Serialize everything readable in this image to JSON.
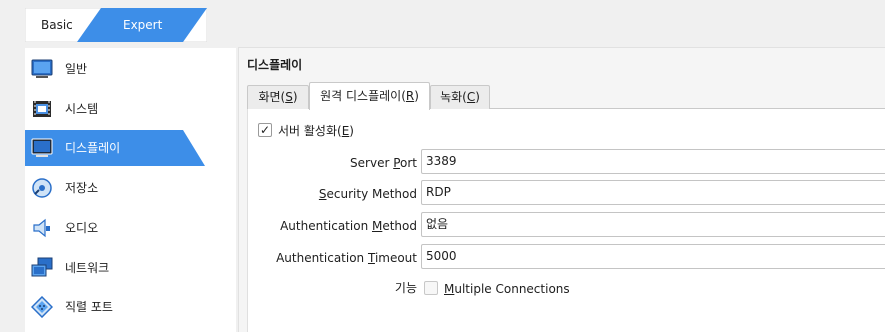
{
  "mode": {
    "basic_label": "Basic",
    "expert_label": "Expert"
  },
  "sidebar": {
    "items": [
      {
        "label": "일반",
        "icon": "monitor-icon"
      },
      {
        "label": "시스템",
        "icon": "chip-icon"
      },
      {
        "label": "디스플레이",
        "icon": "display-icon"
      },
      {
        "label": "저장소",
        "icon": "disk-icon"
      },
      {
        "label": "오디오",
        "icon": "speaker-icon"
      },
      {
        "label": "네트워크",
        "icon": "network-icon"
      },
      {
        "label": "직렬 포트",
        "icon": "serial-port-icon"
      }
    ],
    "active_index": 2
  },
  "panel": {
    "title": "디스플레이",
    "tabs": [
      {
        "text": "화면(",
        "mnemonic": "S",
        "suffix": ")"
      },
      {
        "text": "원격 디스플레이(",
        "mnemonic": "R",
        "suffix": ")"
      },
      {
        "text": "녹화(",
        "mnemonic": "C",
        "suffix": ")"
      }
    ],
    "active_tab": 1
  },
  "remote": {
    "enable_server": {
      "text": "서버 활성화(",
      "mnemonic": "E",
      "suffix": ")",
      "checked": true,
      "mark": "✓"
    },
    "server_port": {
      "pre": "Server ",
      "mnemonic": "P",
      "post": "ort",
      "value": "3389"
    },
    "security_method": {
      "pre": "",
      "mnemonic": "S",
      "post": "ecurity Method",
      "value": "RDP"
    },
    "auth_method": {
      "pre": "Authentication ",
      "mnemonic": "M",
      "post": "ethod",
      "value": "없음"
    },
    "auth_timeout": {
      "pre": "Authentication ",
      "mnemonic": "T",
      "post": "imeout",
      "value": "5000"
    },
    "features": {
      "label": "기능",
      "multiple_connections": {
        "pre": "",
        "mnemonic": "M",
        "post": "ultiple Connections",
        "checked": false
      }
    }
  },
  "colors": {
    "accent": "#3d8ee8",
    "tab_border": "#c9c9c9"
  }
}
